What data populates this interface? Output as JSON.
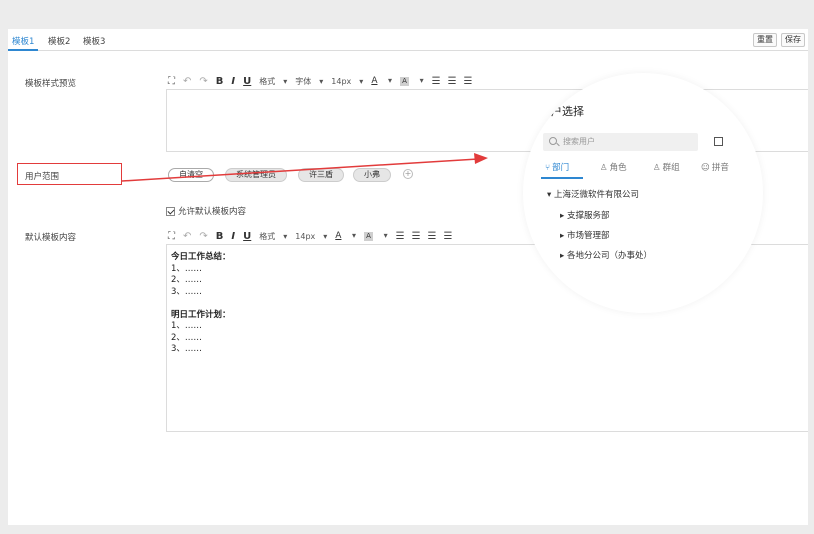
{
  "tabs": [
    {
      "label": "模板1",
      "active": true
    },
    {
      "label": "模板2",
      "active": false
    },
    {
      "label": "模板3",
      "active": false
    }
  ],
  "actions": {
    "reset_label": "重置",
    "save_label": "保存"
  },
  "rows": {
    "preview_label": "模板样式预览",
    "scope_label": "用户范围",
    "default_label": "默认模板内容"
  },
  "toolbar1": {
    "format": "格式",
    "font": "字体",
    "size": "14px"
  },
  "toolbar2": {
    "format": "格式",
    "size": "14px"
  },
  "scope_chips": [
    "自清空",
    "系统管理员",
    "许三盾",
    "小弗"
  ],
  "allow_default_label": "允许默认模板内容",
  "default_content": [
    {
      "text": "今日工作总结：",
      "bold": true
    },
    {
      "text": "1、……",
      "bold": false
    },
    {
      "text": "2、……",
      "bold": false
    },
    {
      "text": "3、……",
      "bold": false
    },
    {
      "text": "",
      "bold": false
    },
    {
      "text": "明日工作计划：",
      "bold": true
    },
    {
      "text": "1、……",
      "bold": false
    },
    {
      "text": "2、……",
      "bold": false
    },
    {
      "text": "3、……",
      "bold": false
    }
  ],
  "user_picker": {
    "title": "用户选择",
    "search_placeholder": "搜索用户",
    "tabs": [
      {
        "label": "部门",
        "active": true,
        "icon": "department-icon"
      },
      {
        "label": "角色",
        "active": false,
        "icon": "user-icon"
      },
      {
        "label": "群组",
        "active": false,
        "icon": "group-icon"
      },
      {
        "label": "拼音",
        "active": false,
        "icon": "pinyin-icon"
      }
    ],
    "tree": [
      {
        "label": "上海泛微软件有限公司",
        "expanded": true,
        "level": 0
      },
      {
        "label": "支撑服务部",
        "expanded": false,
        "level": 1
      },
      {
        "label": "市场管理部",
        "expanded": false,
        "level": 1
      },
      {
        "label": "各地分公司（办事处）",
        "expanded": false,
        "level": 1
      }
    ]
  },
  "colors": {
    "accent": "#2e87d1",
    "annotation_red": "#e23b3b"
  }
}
